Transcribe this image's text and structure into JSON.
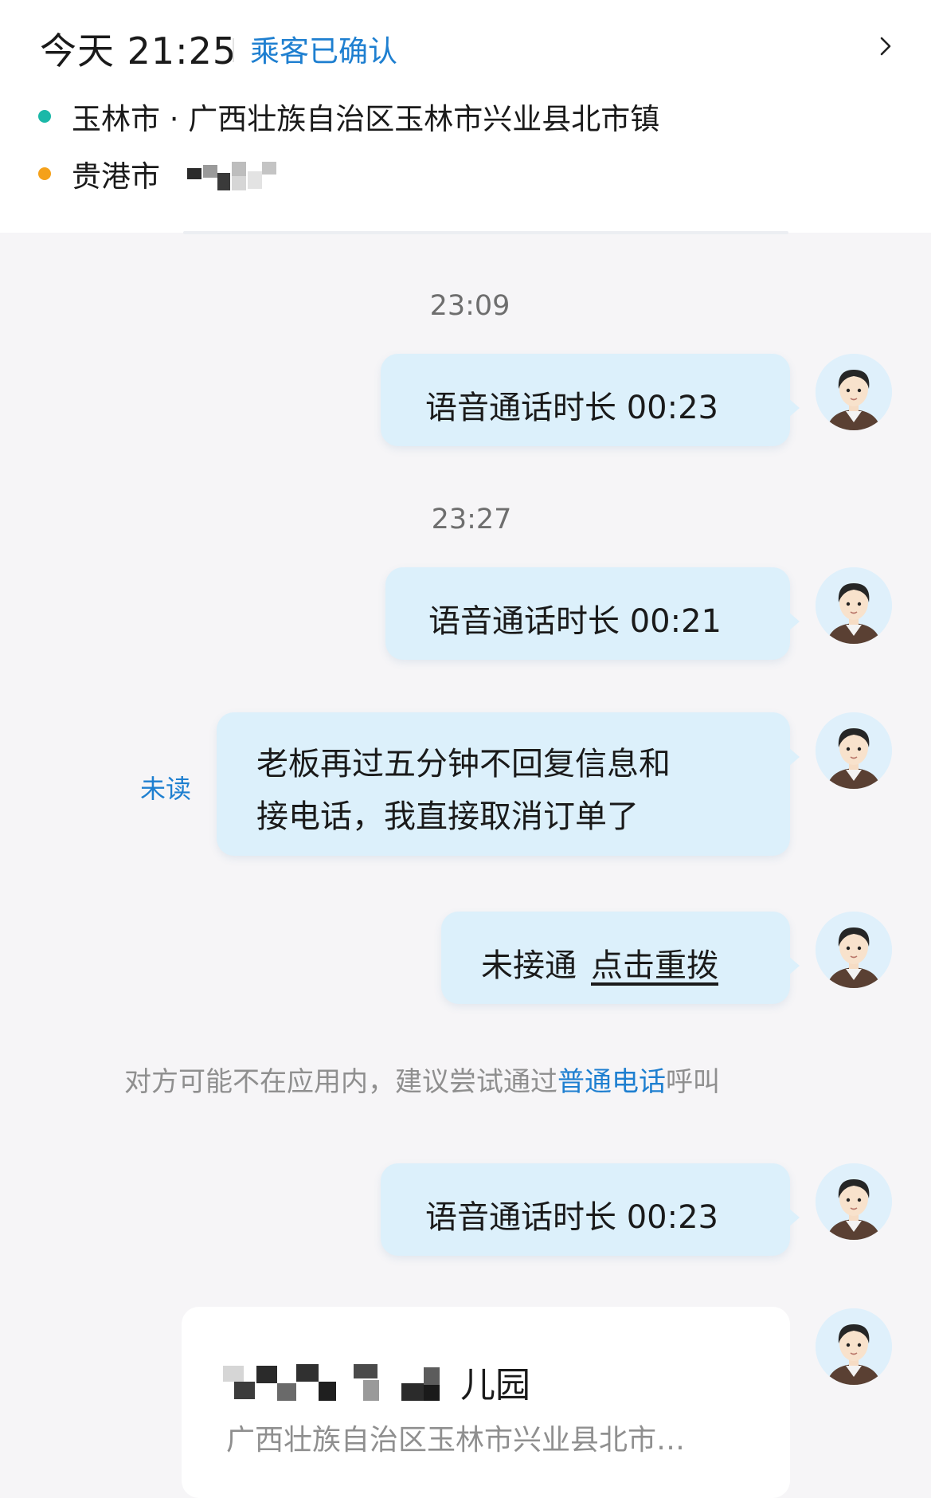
{
  "header": {
    "time": "今天 21:25",
    "status": "乘客已确认",
    "pickup_city": "玉林市 · 广西壮族自治区玉林市兴业县北市镇",
    "dest_city": "贵港市"
  },
  "colors": {
    "accent": "#1e7fd0",
    "bubble": "#dcf0fb",
    "pickup_dot": "#1bb8a8",
    "dest_dot": "#f5a11a",
    "background": "#f6f5f7"
  },
  "messages": [
    {
      "time": "23:09",
      "text": "语音通话时长 00:23"
    },
    {
      "time": "23:27",
      "text": "语音通话时长 00:21"
    },
    {
      "line1": "老板再过五分钟不回复信息和",
      "line2": "接电话，我直接取消订单了",
      "status": "未读"
    },
    {
      "prefix": "未接通",
      "action": "点击重拨"
    },
    {
      "text": "语音通话时长 00:23"
    }
  ],
  "notice": {
    "before": "对方可能不在应用内，建议尝试通过",
    "link": "普通电话",
    "after": "呼叫"
  },
  "location_card": {
    "title_visible": "儿园",
    "address": "广西壮族自治区玉林市兴业县北市…"
  },
  "icons": {
    "chevron": "chevron-right-icon",
    "avatar": "avatar-icon"
  }
}
